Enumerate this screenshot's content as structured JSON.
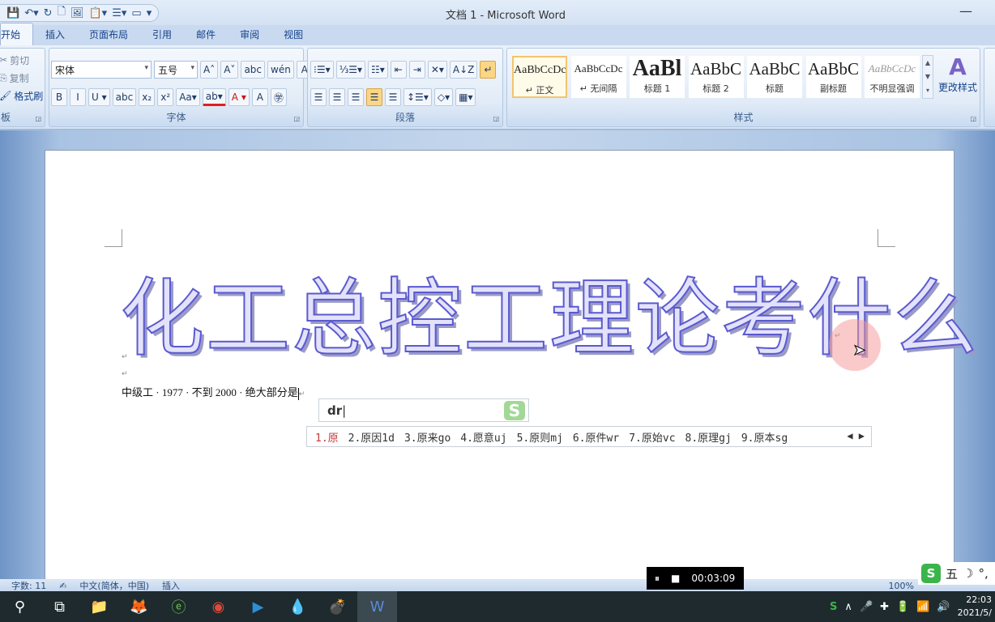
{
  "window": {
    "title": "文档 1 - Microsoft Word",
    "minimize": "—"
  },
  "qat": {
    "icons": [
      "save-icon",
      "undo-icon",
      "redo-icon",
      "new-doc-icon",
      "picture-icon",
      "paste-icon",
      "list-icon",
      "textbox-icon",
      "customize-icon"
    ],
    "glyphs": [
      "💾",
      "↶▾",
      "↻",
      "🗋",
      "🖼",
      "📋▾",
      "☰▾",
      "▭",
      " ▾"
    ]
  },
  "tabs": [
    "开始",
    "插入",
    "页面布局",
    "引用",
    "邮件",
    "审阅",
    "视图"
  ],
  "clipboard": {
    "cut": "剪切",
    "copy": "复制",
    "format_painter": "格式刷",
    "label": "板"
  },
  "font": {
    "name": "宋体",
    "size": "五号",
    "label": "字体",
    "row1": [
      "A˄",
      "A˅",
      "abc",
      "wén",
      "A"
    ],
    "row2": [
      "B",
      "I",
      "U ▾",
      "abc",
      "x₂",
      "x²",
      "Aa▾",
      "ab▾",
      "A ▾",
      "A",
      "㊫"
    ]
  },
  "paragraph": {
    "label": "段落",
    "row1": [
      "⁝☰▾",
      "⅓☰▾",
      "☷▾",
      "⇤",
      "⇥",
      "✕▾",
      "A↓Z",
      "↵"
    ],
    "row2": [
      "☰",
      "☰",
      "☰",
      "☰",
      "☰",
      "↕☰▾",
      "◇▾",
      "▦▾"
    ]
  },
  "styles": {
    "label": "样式",
    "items": [
      {
        "sample": "AaBbCcDc",
        "name": "↵ 正文"
      },
      {
        "sample": "AaBbCcDc",
        "name": "↵ 无间隔"
      },
      {
        "sample": "AaBl",
        "name": "标题 1"
      },
      {
        "sample": "AaBbC",
        "name": "标题 2"
      },
      {
        "sample": "AaBbC",
        "name": "标题"
      },
      {
        "sample": "AaBbC",
        "name": "副标题"
      },
      {
        "sample": "AaBbCcDc",
        "name": "不明显强调"
      }
    ],
    "change_styles": "更改样式"
  },
  "document": {
    "wordart": "化工总控工理论考什么",
    "para_mark": "↵",
    "body": "中级工 · 1977 · 不到 2000 · 绝大部分是"
  },
  "ime": {
    "input": "dr",
    "logo": "S",
    "candidates": [
      "1.原",
      "2.原因1d",
      "3.原来go",
      "4.愿意uj",
      "5.原则mj",
      "6.原件wr",
      "7.原始vc",
      "8.原理gj",
      "9.原本sg"
    ],
    "arrows": "◀ ▶",
    "bar": [
      "五",
      "☽",
      "°,"
    ]
  },
  "status": {
    "words": "字数: 11",
    "language": "中文(简体，中国)",
    "mode": "插入",
    "zoom": "100%"
  },
  "recorder": {
    "pause": "⏸",
    "stop": "■",
    "time": "00:03:09"
  },
  "taskbar": {
    "icons": [
      "search-icon",
      "task-view-icon",
      "file-explorer-icon",
      "uc-browser-icon",
      "ie-browser-icon",
      "chrome-icon",
      "media-player-icon",
      "flame-app-icon",
      "bomb-app-icon",
      "word-icon"
    ],
    "glyphs": [
      "⚲",
      "⧉",
      "📁",
      "🦊",
      "ⓔ",
      "◉",
      "▶",
      "💧",
      "💣",
      "W"
    ]
  },
  "tray": {
    "glyphs": [
      "S",
      "∧",
      "🎤",
      "✚",
      "🔋",
      "📶",
      "🔊"
    ],
    "time": "22:03",
    "date": "2021/5/"
  }
}
